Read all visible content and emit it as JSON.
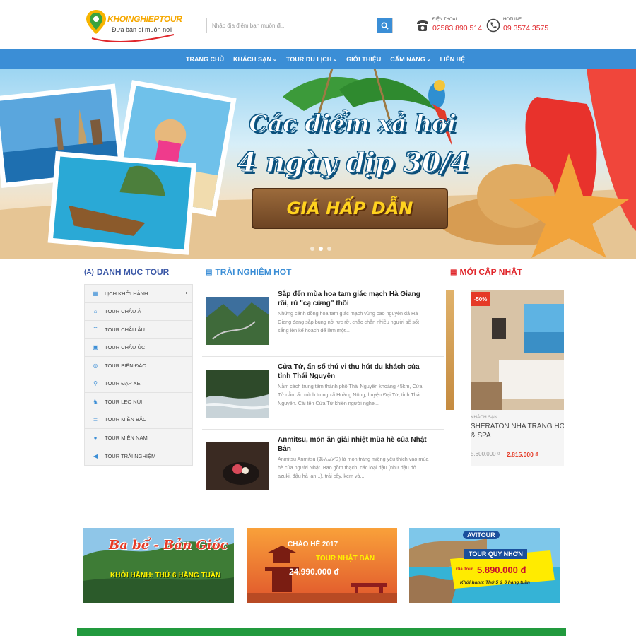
{
  "header": {
    "logo": {
      "name_part1": "KHOINGHIEP",
      "name_part2": "TOUR",
      "slogan": "Đưa bạn đi muôn nơi"
    },
    "search": {
      "placeholder": "Nhập địa điểm bạn muốn đi..."
    },
    "phone": {
      "label": "ĐIỆN THOẠI",
      "value": "02583 890 514"
    },
    "hotline": {
      "label": "HOTLINE",
      "value": "09 3574 3575"
    }
  },
  "nav": {
    "items": [
      {
        "label": "TRANG CHỦ",
        "has_dropdown": false
      },
      {
        "label": "KHÁCH SẠN",
        "has_dropdown": true
      },
      {
        "label": "TOUR DU LỊCH",
        "has_dropdown": true
      },
      {
        "label": "GIỚI THIỆU",
        "has_dropdown": false
      },
      {
        "label": "CẨM NANG",
        "has_dropdown": true
      },
      {
        "label": "LIÊN HỆ",
        "has_dropdown": false
      }
    ]
  },
  "banner": {
    "line1": "Các điểm xả hơi",
    "line2": "4 ngày dịp 30/4",
    "sign": "GIÁ HẤP DẪN",
    "slides": 3,
    "active_slide": 1
  },
  "sections": {
    "category_title": "DANH MỤC TOUR",
    "hot_title": "TRẢI NGHIỆM HOT",
    "new_title": "MỚI CẬP NHẬT"
  },
  "categories": [
    {
      "label": "LỊCH KHỞI HÀNH",
      "icon": "calendar-grid-icon"
    },
    {
      "label": "TOUR CHÂU Á",
      "icon": "building-icon"
    },
    {
      "label": "TOUR CHÂU ÂU",
      "icon": "wifi-icon"
    },
    {
      "label": "TOUR CHÂU ÚC",
      "icon": "bus-icon"
    },
    {
      "label": "TOUR BIỂN ĐẢO",
      "icon": "lifebuoy-icon"
    },
    {
      "label": "TOUR ĐẠP XE",
      "icon": "bicycle-icon"
    },
    {
      "label": "TOUR LEO NÚI",
      "icon": "footprint-icon"
    },
    {
      "label": "TOUR MIỀN BẮC",
      "icon": "layers-icon"
    },
    {
      "label": "TOUR MIỀN NAM",
      "icon": "map-pin-icon"
    },
    {
      "label": "TOUR TRẢI NGHIỆM",
      "icon": "megaphone-icon"
    }
  ],
  "articles": [
    {
      "title": "Sắp đến mùa hoa tam giác mạch Hà Giang rồi, rủ \"cạ cứng\" thôi",
      "desc": "Những cánh đồng hoa tam giác mạch vùng cao nguyên đá Hà Giang đang sắp bung nở rực rỡ, chắc chắn nhiều người sẽ sốt sắng lên kế hoạch để làm một..."
    },
    {
      "title": "Cửa Tử, ẩn số thú vị thu hút du khách của tỉnh Thái Nguyên",
      "desc": "Nằm cách trung tâm thành phố Thái Nguyên khoảng 45km, Cửa Tử nằm ẩn mình trong xã Hoàng Nông, huyện Đại Từ, tỉnh Thái Nguyên. Cái tên Cửa Tử khiến người nghe..."
    },
    {
      "title": "Anmitsu, món ăn giải nhiệt mùa hè của Nhật Bản",
      "desc": "Anmitsu Anmitsu (あんみつ) là món tráng miệng yêu thích vào mùa hè của người Nhật. Bao gồm thạch, các loại đậu (như đậu đỏ azuki, đậu hà lan...), trái cây, kem và..."
    }
  ],
  "new_update": {
    "sale_badge": "-50%",
    "category": "KHÁCH SẠN",
    "name_line1": "SHERATON NHA TRANG HOTEL",
    "name_line2": "& SPA",
    "old_price": "5.600.000 ₫",
    "new_price": "2.815.000 ₫"
  },
  "ads": [
    {
      "line1": "Ba bể - Bản Giốc",
      "line2": "KHỞI HÀNH: THỨ 6 HÀNG TUẦN"
    },
    {
      "line1": "CHÀO HÈ 2017",
      "line2": "TOUR NHẬT BẢN",
      "price": "24.990.000 đ"
    },
    {
      "brand": "AVITOUR",
      "line1": "TOUR QUY NHƠN",
      "price_label": "Giá Tour",
      "price": "5.890.000 đ",
      "line2": "Khởi hành: Thứ 5 & 6 hàng tuần"
    }
  ],
  "colors": {
    "primary_blue": "#3b8ed6",
    "category_title": "#3a57a6",
    "new_title": "#e0262b",
    "sale_red": "#e53a26",
    "footer_green": "#229a3e"
  }
}
